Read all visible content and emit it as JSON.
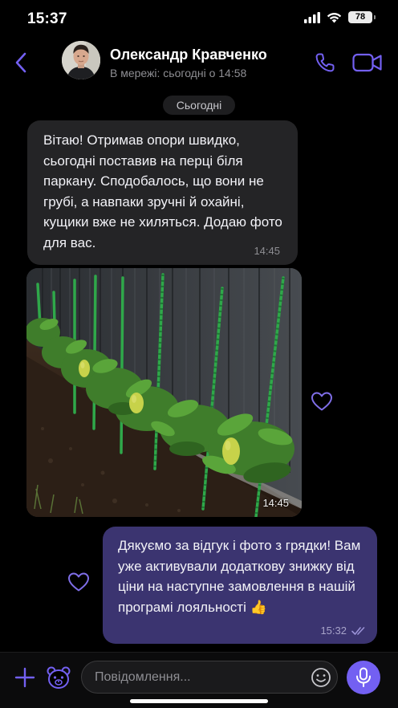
{
  "status_bar": {
    "time": "15:37",
    "battery_level": "78",
    "icons": [
      "signal-icon",
      "wifi-icon",
      "battery-icon"
    ]
  },
  "header": {
    "contact_name": "Олександр Кравченко",
    "contact_status": "В мережі: сьогодні о 14:58",
    "icons": [
      "back-arrow-icon",
      "phone-icon",
      "video-camera-icon"
    ],
    "accent_color": "#7360f2"
  },
  "date_separator": "Сьогодні",
  "messages": [
    {
      "direction": "incoming",
      "type": "text",
      "text": "Вітаю! Отримав опори швидко, сьогодні поставив на перці біля паркану. Сподобалось, що вони не грубі, а навпаки зручні й охайні, кущики вже не хиляться. Додаю фото для вас.",
      "time": "14:45"
    },
    {
      "direction": "incoming",
      "type": "photo",
      "photo_subject": "pepper plants tied to green support stakes along a grey fence",
      "time": "14:45",
      "reaction_icon": "heart-outline-icon"
    },
    {
      "direction": "outgoing",
      "type": "text",
      "text": "Дякуємо за відгук і фото з грядки! Вам уже активували додаткову знижку від ціни на наступне замовлення в нашій програмі лояльності 👍",
      "time": "15:32",
      "read_state": "double-check-icon",
      "reaction_icon": "heart-outline-icon"
    }
  ],
  "composer": {
    "placeholder": "Повідомлення...",
    "value": "",
    "icons": [
      "plus-icon",
      "sticker-bear-icon",
      "emoji-smile-icon",
      "microphone-icon"
    ]
  },
  "colors": {
    "background": "#000000",
    "incoming_bubble": "#242426",
    "outgoing_bubble": "#3b3470",
    "accent": "#7360f2"
  }
}
